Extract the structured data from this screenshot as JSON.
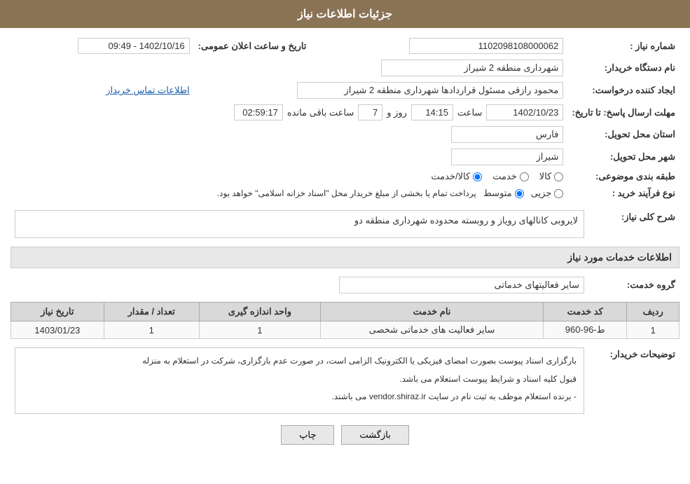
{
  "header": {
    "title": "جزئیات اطلاعات نیاز"
  },
  "fields": {
    "shomara_niaz_label": "شماره نیاز :",
    "shomara_niaz_value": "1102098108000062",
    "name_dastgah_label": "نام دستگاه خریدار:",
    "name_dastgah_value": "شهرداری منطقه 2 شیراز",
    "ijad_label": "ایجاد کننده درخواست:",
    "ijad_value": "محمود رازقی مسئول قراردادها شهرداری منطقه 2 شیراز",
    "ettelaat_tamas_link": "اطلاعات تماس خریدار",
    "mohlat_label": "مهلت ارسال پاسخ: تا تاریخ:",
    "date_value": "1402/10/23",
    "saat_label": "ساعت",
    "saat_value": "14:15",
    "roz_label": "روز و",
    "roz_value": "7",
    "baqi_label": "ساعت باقی مانده",
    "baqi_value": "02:59:17",
    "tarikh_aalan_label": "تاریخ و ساعت اعلان عمومی:",
    "tarikh_aalan_value": "1402/10/16 - 09:49",
    "ostan_label": "استان محل تحویل:",
    "ostan_value": "فارس",
    "shahr_label": "شهر محل تحویل:",
    "shahr_value": "شیراز",
    "tabaqa_label": "طبقه بندی موضوعی:",
    "tabaqa_kala": "کالا",
    "tabaqa_khedmat": "خدمت",
    "tabaqa_kala_khedmat": "کالا/خدمت",
    "tabaqa_selected": "kala_khedmat",
    "noue_farayand_label": "نوع فرآیند خرید :",
    "noue_jozii": "جزیی",
    "noue_motevaset": "متوسط",
    "noue_note": "پرداخت تمام یا بخشی از مبلغ خریدار محل \"اسناد خزانه اسلامی\" خواهد بود.",
    "sharh_label": "شرح کلی نیاز:",
    "sharh_value": "لایروبی کانالهای رویاز و روبسته محدوده شهرداری منطقه دو",
    "services_section_title": "اطلاعات خدمات مورد نیاز",
    "gorouh_label": "گروه خدمت:",
    "gorouh_value": "سایر فعالیتهای خدماتی",
    "table": {
      "headers": [
        "ردیف",
        "کد خدمت",
        "نام خدمت",
        "واحد اندازه گیری",
        "تعداد / مقدار",
        "تاریخ نیاز"
      ],
      "rows": [
        {
          "radif": "1",
          "kod": "ط-96-960",
          "nam": "سایر فعالیت های خدماتی شخصی",
          "vahed": "1",
          "tedad": "1",
          "tarikh": "1403/01/23"
        }
      ]
    },
    "tawzih_label": "توضیحات خریدار:",
    "tawzih_lines": [
      "بارگزاری اسناد پیوست بصورت امضای فیزیکی یا الکترونیک الزامی است، در صورت عدم بارگزاری، شرکت در استعلام به منزله",
      "قبول کلیه اسناد و شرایط پیوست استعلام می باشد.",
      "- برنده استعلام موظف به ثبت نام در سایت vendor.shiraz.ir می باشند."
    ],
    "btn_print": "چاپ",
    "btn_back": "بازگشت"
  }
}
